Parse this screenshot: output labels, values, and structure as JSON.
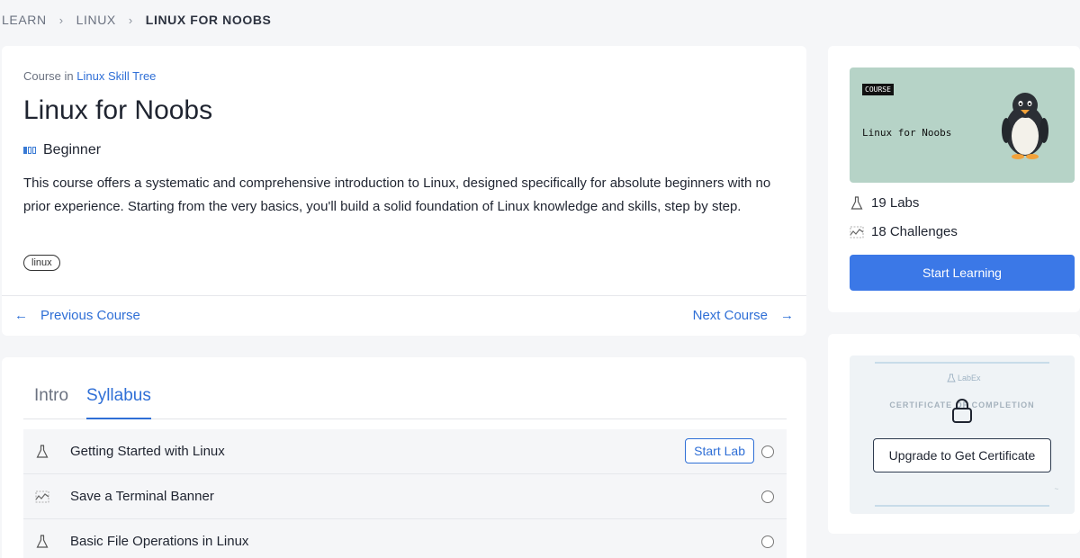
{
  "breadcrumb": {
    "items": [
      "LEARN",
      "LINUX",
      "LINUX FOR NOOBS"
    ]
  },
  "course": {
    "course_in_prefix": "Course in",
    "skill_tree": "Linux Skill Tree",
    "title": "Linux for Noobs",
    "level": "Beginner",
    "description": "This course offers a systematic and comprehensive introduction to Linux, designed specifically for absolute beginners with no prior experience. Starting from the very basics, you'll build a solid foundation of Linux knowledge and skills, step by step.",
    "tag": "linux"
  },
  "nav": {
    "prev_label": "Previous Course",
    "next_label": "Next Course"
  },
  "tabs": {
    "intro": "Intro",
    "syllabus": "Syllabus",
    "active": "Syllabus"
  },
  "syllabus": {
    "items": [
      {
        "label": "Getting Started with Linux",
        "type": "lab",
        "action": "Start Lab"
      },
      {
        "label": "Save a Terminal Banner",
        "type": "challenge"
      },
      {
        "label": "Basic File Operations in Linux",
        "type": "lab"
      }
    ]
  },
  "sidebar": {
    "thumb_badge": "COURSE",
    "thumb_title": "Linux for Noobs",
    "labs": "19 Labs",
    "challenges": "18 Challenges",
    "start_button": "Start Learning"
  },
  "certificate": {
    "logo": "LabEx",
    "text": "CERTIFICATE OF COMPLETION",
    "upgrade_button": "Upgrade to Get Certificate"
  },
  "colors": {
    "accent": "#3b78e7",
    "link": "#2f6fd6",
    "thumb_bg": "#b6d3c7"
  }
}
